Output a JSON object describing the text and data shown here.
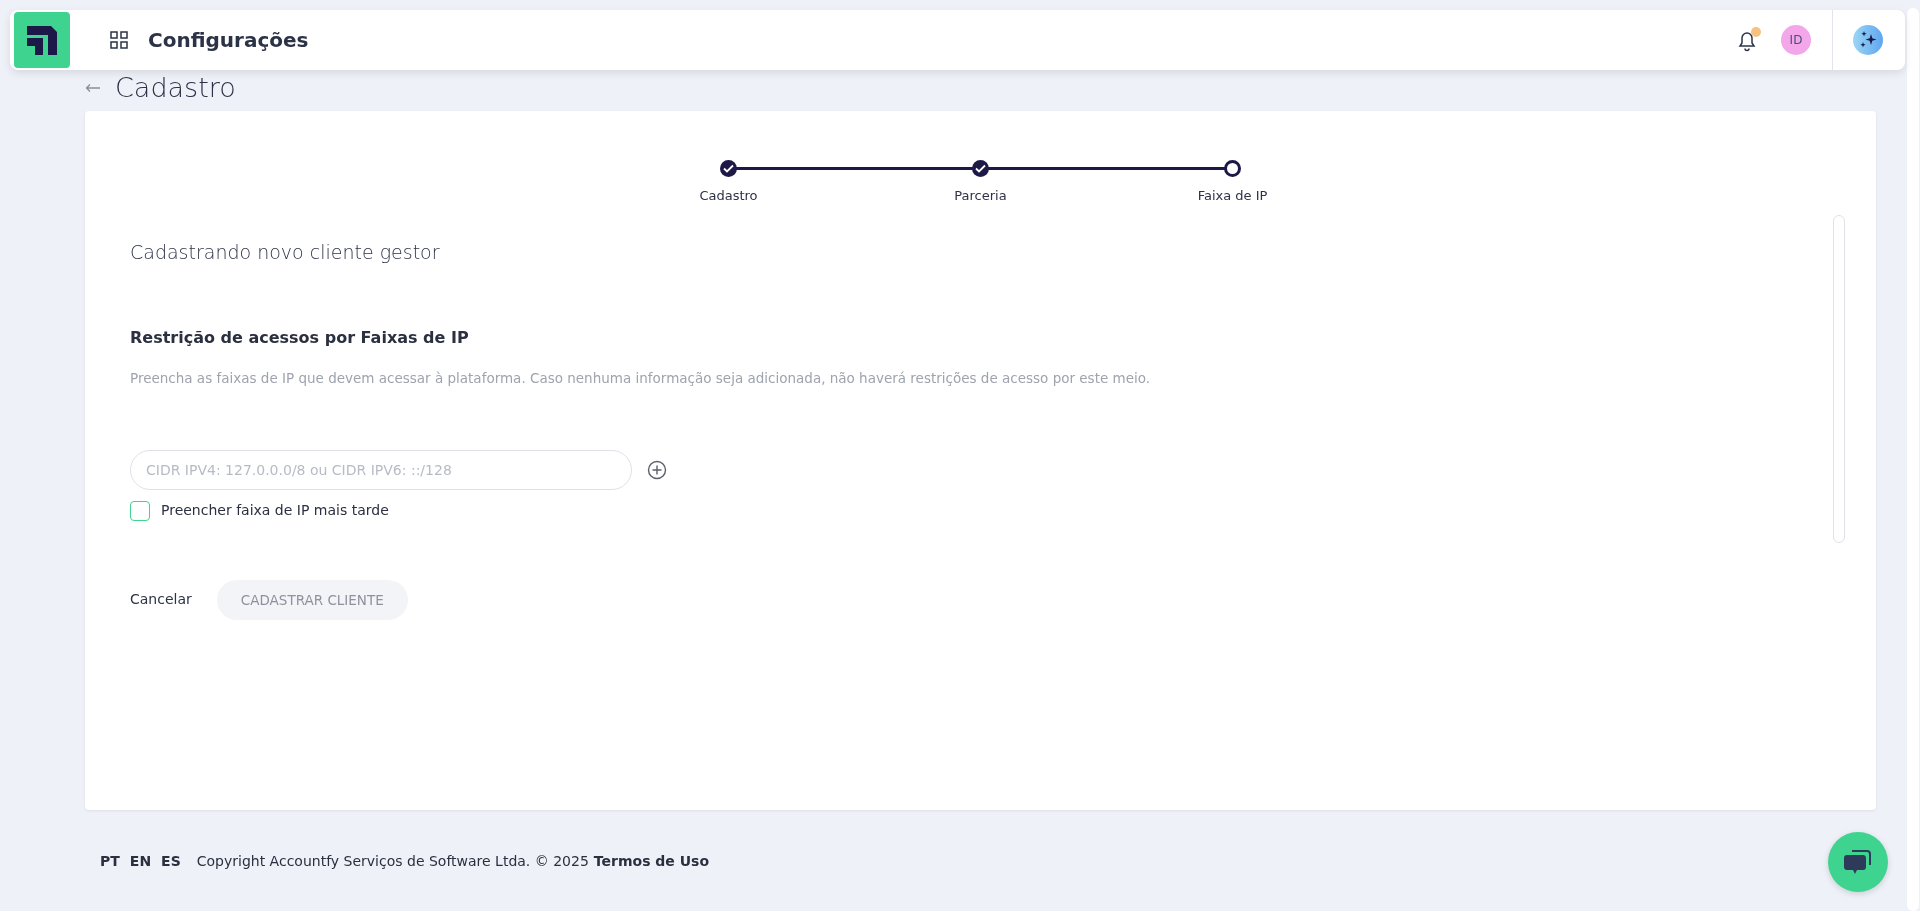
{
  "header": {
    "title": "Configurações",
    "notification": {
      "unread": true
    },
    "avatar": {
      "initials": "ID"
    }
  },
  "page": {
    "title": "Cadastro"
  },
  "stepper": [
    {
      "label": "Cadastro",
      "done": true
    },
    {
      "label": "Parceria",
      "done": true
    },
    {
      "label": "Faixa de IP",
      "done": false
    }
  ],
  "form": {
    "heading": "Cadastrando novo cliente gestor",
    "section_title": "Restrição de acessos por Faixas de IP",
    "description": "Preencha as faixas de IP que devem acessar à plataforma. Caso nenhuma informação seja adicionada, não haverá restrições de acesso por este meio.",
    "ip_field": {
      "placeholder": "CIDR IPV4: 127.0.0.0/8 ou CIDR IPV6: ::/128"
    },
    "later_checkbox": {
      "label": "Preencher faixa de IP mais tarde",
      "checked": false
    }
  },
  "buttons": [
    {
      "label": "Cancelar",
      "kind": "link"
    },
    {
      "label": "CADASTRAR CLIENTE",
      "kind": "primary",
      "disabled": true
    }
  ],
  "footer": {
    "languages": [
      "PT",
      "EN",
      "ES"
    ],
    "copyright": "Copyright Accountfy Serviços de Software Ltda. © 2025",
    "terms": "Termos de Uso"
  }
}
